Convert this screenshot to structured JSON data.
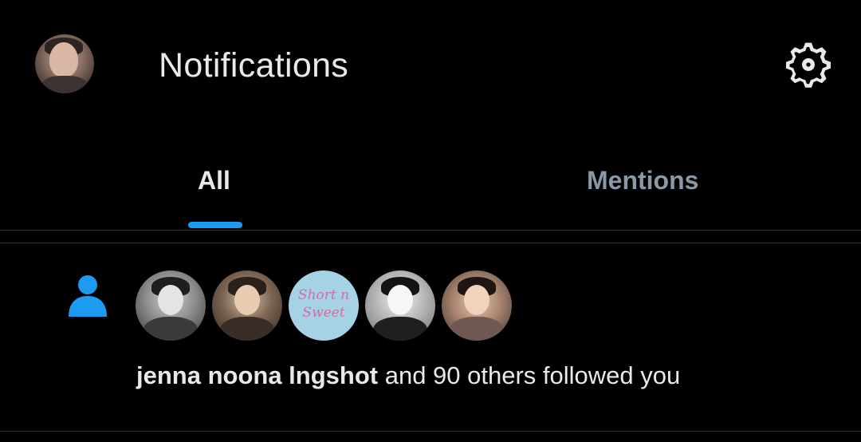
{
  "header": {
    "title": "Notifications",
    "avatar_icon": "profile-avatar",
    "settings_icon": "gear-icon"
  },
  "tabs": [
    {
      "label": "All",
      "active": true
    },
    {
      "label": "Mentions",
      "active": false
    }
  ],
  "notification": {
    "type_icon": "person-icon",
    "follower_avatars": [
      {
        "name": "follower-avatar-1"
      },
      {
        "name": "follower-avatar-2"
      },
      {
        "name": "follower-avatar-3",
        "text": "Short n Sweet"
      },
      {
        "name": "follower-avatar-4"
      },
      {
        "name": "follower-avatar-5"
      }
    ],
    "actor_name": "jenna noona lngshot",
    "message_rest": " and 90 others followed you"
  },
  "colors": {
    "background": "#000000",
    "accent": "#1d9bf0",
    "text_primary": "#e7e9ea",
    "text_secondary": "#8b98a5",
    "divider": "#2f3336"
  }
}
